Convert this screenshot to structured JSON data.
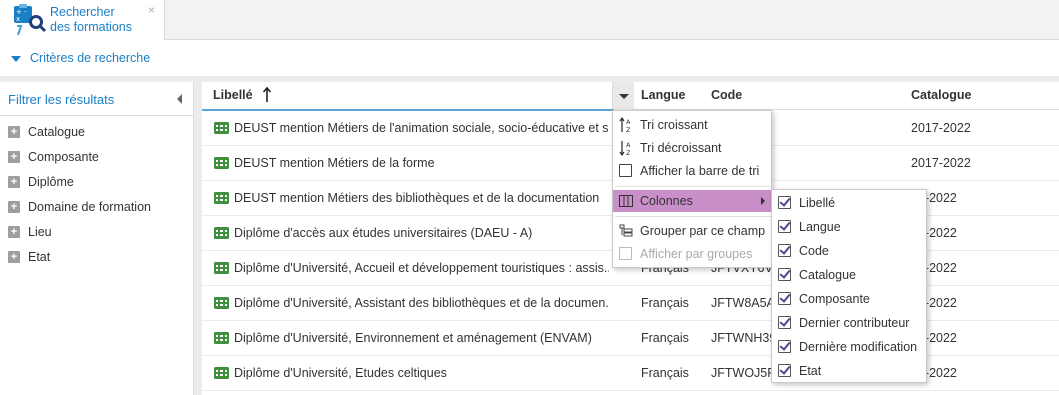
{
  "tab": {
    "title_line1": "Rechercher",
    "title_line2": "des formations",
    "close_glyph": "×",
    "icon": "search-training-icon"
  },
  "criteria": {
    "label": "Critères de recherche"
  },
  "filters": {
    "title": "Filtrer les résultats",
    "items": [
      {
        "label": "Catalogue"
      },
      {
        "label": "Composante"
      },
      {
        "label": "Diplôme"
      },
      {
        "label": "Domaine de formation"
      },
      {
        "label": "Lieu"
      },
      {
        "label": "Etat"
      }
    ]
  },
  "grid": {
    "columns": {
      "libelle": "Libellé",
      "langue": "Langue",
      "code": "Code",
      "catalogue": "Catalogue"
    },
    "rows": [
      {
        "libelle": "DEUST mention Métiers de l'animation sociale, socio-éducative et s...",
        "langue": "",
        "code": "",
        "catalogue": "2017-2022"
      },
      {
        "libelle": "DEUST mention Métiers de la forme",
        "langue": "",
        "code": "",
        "catalogue": "2017-2022"
      },
      {
        "libelle": "DEUST mention Métiers des bibliothèques et de la documentation",
        "langue": "",
        "code": "",
        "catalogue": "17-2022"
      },
      {
        "libelle": "Diplôme d'accès aux études universitaires (DAEU - A)",
        "langue": "",
        "code": "",
        "catalogue": "17-2022"
      },
      {
        "libelle": "Diplôme d'Université, Accueil et développement touristiques : assis...",
        "langue": "Français",
        "code": "JFTVXY6V",
        "catalogue": "17-2022"
      },
      {
        "libelle": "Diplôme d'Université, Assistant des bibliothèques et de la documen...",
        "langue": "Français",
        "code": "JFTW8A5A",
        "catalogue": "17-2022"
      },
      {
        "libelle": "Diplôme d'Université, Environnement et aménagement (ENVAM)",
        "langue": "Français",
        "code": "JFTWNH39",
        "catalogue": "17-2022"
      },
      {
        "libelle": "Diplôme d'Université, Etudes celtiques",
        "langue": "Français",
        "code": "JFTWOJ5R",
        "catalogue": "17-2022"
      }
    ]
  },
  "column_menu": {
    "sort_asc": "Tri croissant",
    "sort_desc": "Tri décroissant",
    "show_sort_bar": "Afficher la barre de tri",
    "columns": "Colonnes",
    "group_by": "Grouper par ce champ",
    "show_groups": "Afficher par groupes"
  },
  "columns_submenu": {
    "items": [
      {
        "label": "Libellé",
        "checked": true
      },
      {
        "label": "Langue",
        "checked": true
      },
      {
        "label": "Code",
        "checked": true
      },
      {
        "label": "Catalogue",
        "checked": true
      },
      {
        "label": "Composante",
        "checked": true
      },
      {
        "label": "Dernier contributeur",
        "checked": true
      },
      {
        "label": "Dernière modification",
        "checked": true
      },
      {
        "label": "Etat",
        "checked": true
      }
    ]
  },
  "colors": {
    "accent": "#1a7fc6",
    "menu_highlight": "#c98fc8",
    "row_icon": "#3f8f3f"
  }
}
